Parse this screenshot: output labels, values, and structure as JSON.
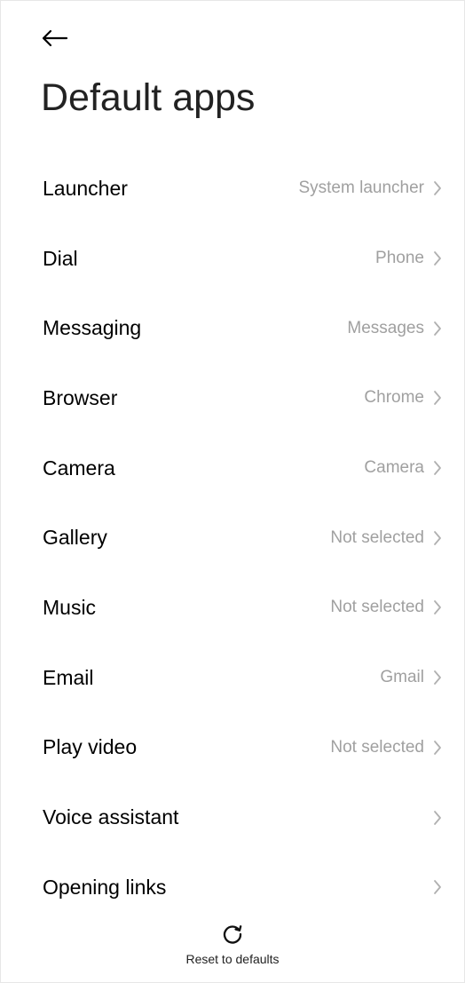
{
  "header": {
    "back_icon": "back-arrow-icon",
    "title": "Default apps"
  },
  "rows": [
    {
      "label": "Launcher",
      "value": "System launcher"
    },
    {
      "label": "Dial",
      "value": "Phone"
    },
    {
      "label": "Messaging",
      "value": "Messages"
    },
    {
      "label": "Browser",
      "value": "Chrome"
    },
    {
      "label": "Camera",
      "value": "Camera"
    },
    {
      "label": "Gallery",
      "value": "Not selected"
    },
    {
      "label": "Music",
      "value": "Not selected"
    },
    {
      "label": "Email",
      "value": "Gmail"
    },
    {
      "label": "Play video",
      "value": "Not selected"
    },
    {
      "label": "Voice assistant",
      "value": ""
    },
    {
      "label": "Opening links",
      "value": ""
    }
  ],
  "footer": {
    "reset_icon": "refresh-icon",
    "reset_label": "Reset to defaults"
  },
  "colors": {
    "text": "#000000",
    "secondary_text": "#a0a0a0",
    "chevron": "#b0b0b0",
    "background": "#ffffff"
  }
}
